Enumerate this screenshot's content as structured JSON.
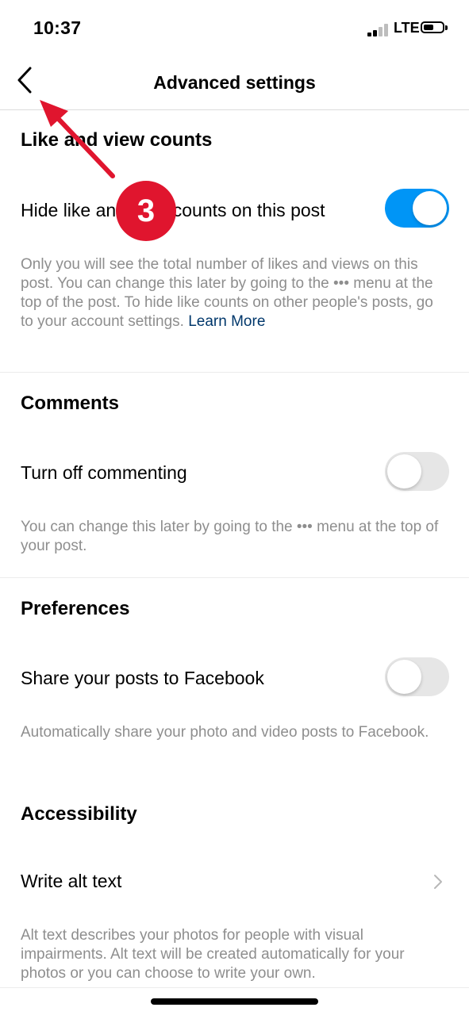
{
  "status_bar": {
    "time": "10:37",
    "network": "LTE"
  },
  "nav": {
    "title": "Advanced settings"
  },
  "sections": {
    "likes": {
      "title": "Like and view counts",
      "row_label": "Hide like and view counts on this post",
      "toggle_on": true,
      "description": "Only you will see the total number of likes and views on this post. You can change this later by going to the ••• menu at the top of the post. To hide like counts on other people's posts, go to your account settings.",
      "learn_more": "Learn More"
    },
    "comments": {
      "title": "Comments",
      "row_label": "Turn off commenting",
      "toggle_on": false,
      "description": "You can change this later by going to the ••• menu at the top of your post."
    },
    "preferences": {
      "title": "Preferences",
      "row_label": "Share your posts to Facebook",
      "toggle_on": false,
      "description": "Automatically share your photo and video posts to Facebook."
    },
    "accessibility": {
      "title": "Accessibility",
      "row_label": "Write alt text",
      "description": "Alt text describes your photos for people with visual impairments. Alt text will be created automatically for your photos or you can choose to write your own."
    }
  },
  "annotation": {
    "step": "3"
  },
  "colors": {
    "accent": "#0095f6",
    "annotation": "#e0152e",
    "link": "#00376b"
  },
  "icons": {
    "back": "chevron-left-icon",
    "row_arrow": "chevron-right-icon"
  }
}
